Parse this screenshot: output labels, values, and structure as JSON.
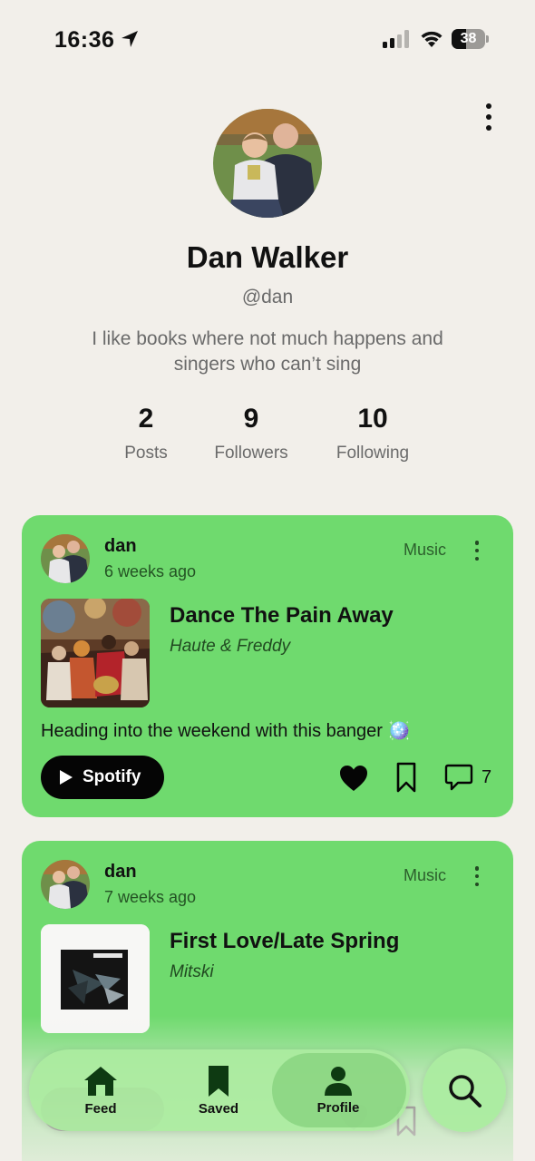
{
  "status_bar": {
    "time": "16:36",
    "battery": "38"
  },
  "profile": {
    "name": "Dan Walker",
    "handle": "@dan",
    "bio": "I like books where not much happens and singers who can’t sing",
    "stats": [
      {
        "value": "2",
        "label": "Posts"
      },
      {
        "value": "9",
        "label": "Followers"
      },
      {
        "value": "10",
        "label": "Following"
      }
    ]
  },
  "posts": [
    {
      "user": "dan",
      "time_ago": "6 weeks ago",
      "category": "Music",
      "title": "Dance The Pain Away",
      "artist": "Haute & Freddy",
      "caption": "Heading into the weekend with this banger 🪩",
      "button": "Spotify",
      "comment_count": "7"
    },
    {
      "user": "dan",
      "time_ago": "7 weeks ago",
      "category": "Music",
      "title": "First Love/Late Spring",
      "artist": "Mitski",
      "caption": "",
      "button": "",
      "comment_count": ""
    }
  ],
  "nav": {
    "items": [
      {
        "label": "Feed",
        "icon": "home-icon"
      },
      {
        "label": "Saved",
        "icon": "bookmark-icon"
      },
      {
        "label": "Profile",
        "icon": "person-icon",
        "active": true
      }
    ],
    "search_icon": "search-icon"
  },
  "colors": {
    "background": "#f2efea",
    "card": "#6fda6e",
    "nav": "#abeca0"
  }
}
